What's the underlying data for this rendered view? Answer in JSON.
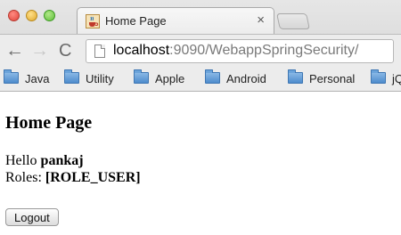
{
  "window": {
    "controls": [
      "close",
      "minimize",
      "zoom"
    ]
  },
  "tab": {
    "title": "Home Page",
    "favicon": "java-coffee-cup-icon",
    "close_label": "×"
  },
  "toolbar": {
    "back_label": "←",
    "forward_label": "→",
    "reload_label": "C"
  },
  "address_bar": {
    "host": "localhost",
    "rest": ":9090/WebappSpringSecurity/"
  },
  "bookmarks": [
    {
      "label": "Java"
    },
    {
      "label": "Utility"
    },
    {
      "label": "Apple"
    },
    {
      "label": "Android"
    },
    {
      "label": "Personal"
    },
    {
      "label": "jQ"
    }
  ],
  "page": {
    "heading": "Home Page",
    "hello_prefix": "Hello ",
    "username": "pankaj",
    "roles_prefix": "Roles: ",
    "roles_value": "[ROLE_USER]",
    "logout_label": "Logout"
  }
}
